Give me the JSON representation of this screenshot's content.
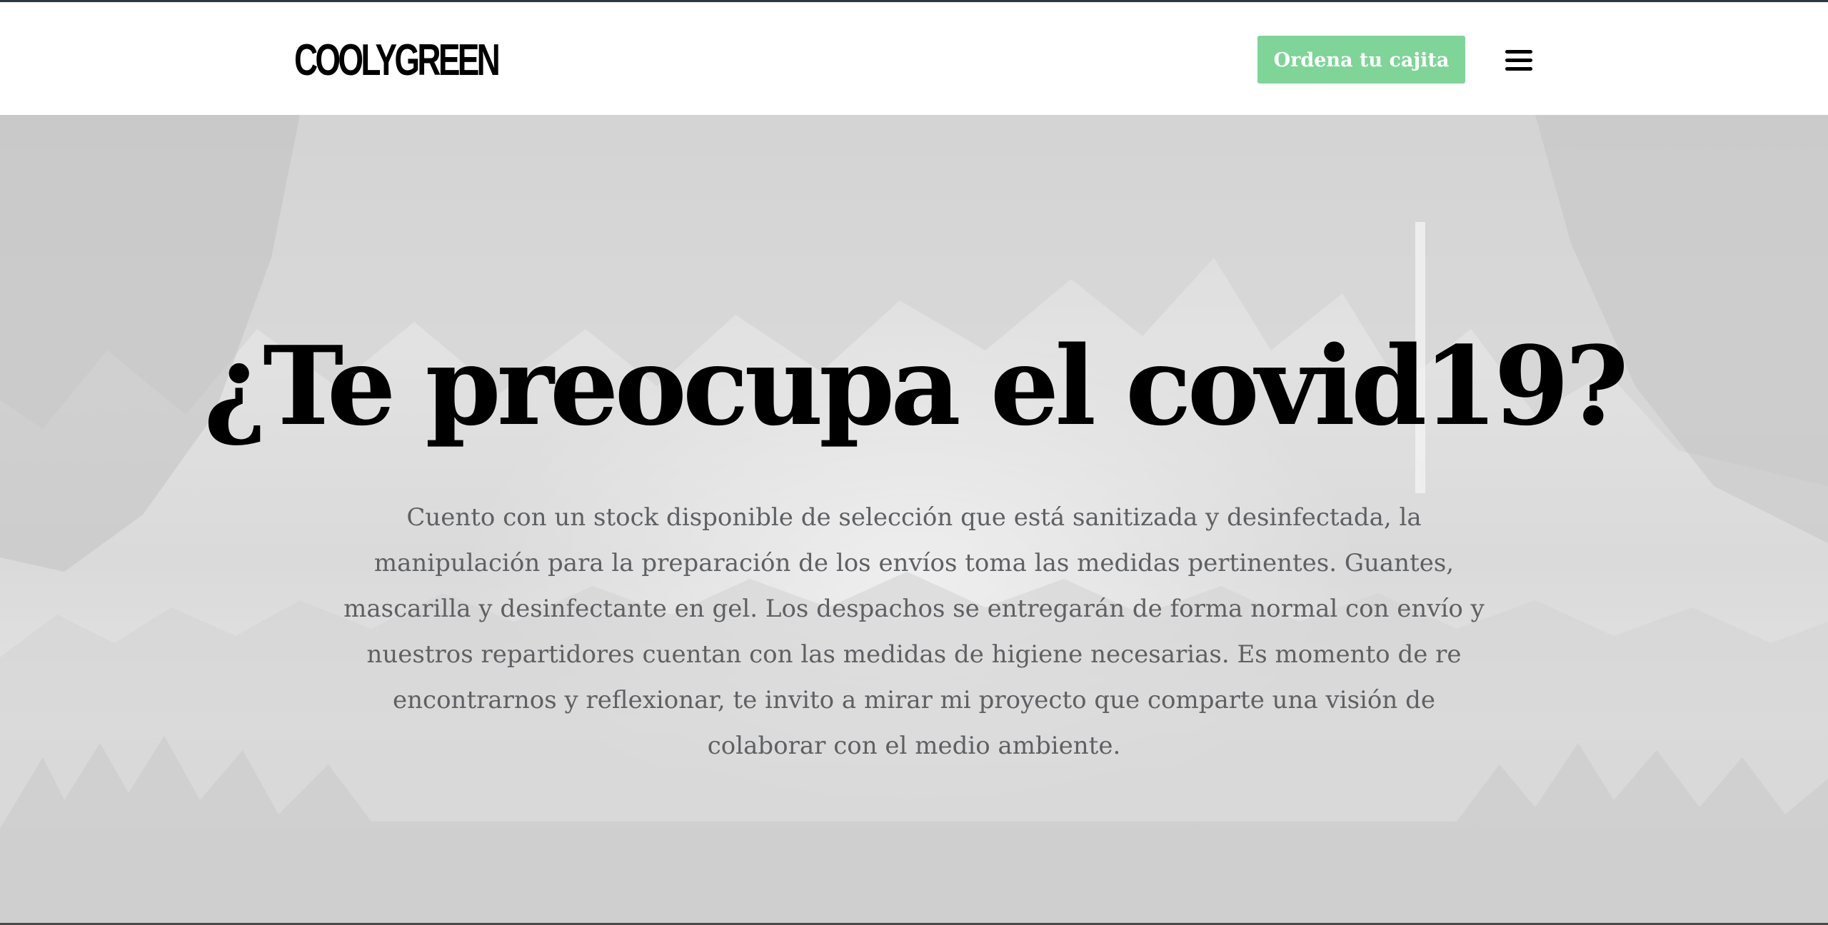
{
  "header": {
    "logo": "COOLYGREEN",
    "cta_label": "Ordena tu cajita",
    "menu_icon": "hamburger-menu-icon"
  },
  "hero": {
    "title": "¿Te preocupa el covid19?",
    "paragraph": "Cuento con un stock disponible de selección que está sanitizada y desinfectada, la manipulación para la preparación de los envíos toma las medidas pertinentes. Guantes, mascarilla y desinfectante en gel. Los despachos se entregarán de forma normal con envío y nuestros repartidores cuentan con las medidas de higiene necesarias. Es momento de re encontrarnos y reflexionar, te invito a mirar mi proyecto que comparte una visión de colaborar con el medio ambiente."
  },
  "colors": {
    "accent": "#7fd497",
    "text_dark": "#000000",
    "text_muted": "#5f6063"
  }
}
